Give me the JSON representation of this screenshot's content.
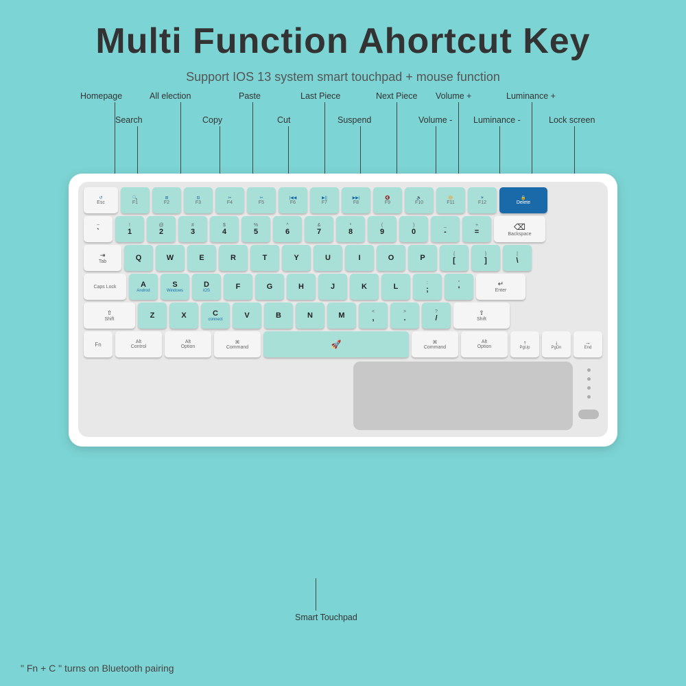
{
  "title": "Multi Function Ahortcut Key",
  "subtitle": "Support IOS 13 system smart touchpad + mouse function",
  "labels": {
    "homepage": "Homepage",
    "all_election": "All election",
    "paste": "Paste",
    "last_piece": "Last Piece",
    "next_piece": "Next Piece",
    "volume_plus": "Volume +",
    "luminance_plus": "Luminance +",
    "search": "Search",
    "copy": "Copy",
    "cut": "Cut",
    "suspend": "Suspend",
    "volume_minus": "Volume -",
    "luminance_minus": "Luminance -",
    "lock_screen": "Lock screen",
    "smart_touchpad": "Smart Touchpad",
    "footer": "\" Fn + C \" turns on Bluetooth pairing"
  },
  "keyboard": {
    "rows": [
      "fn_row",
      "number_row",
      "qwerty_row",
      "asdf_row",
      "zxcv_row",
      "bottom_row"
    ]
  }
}
